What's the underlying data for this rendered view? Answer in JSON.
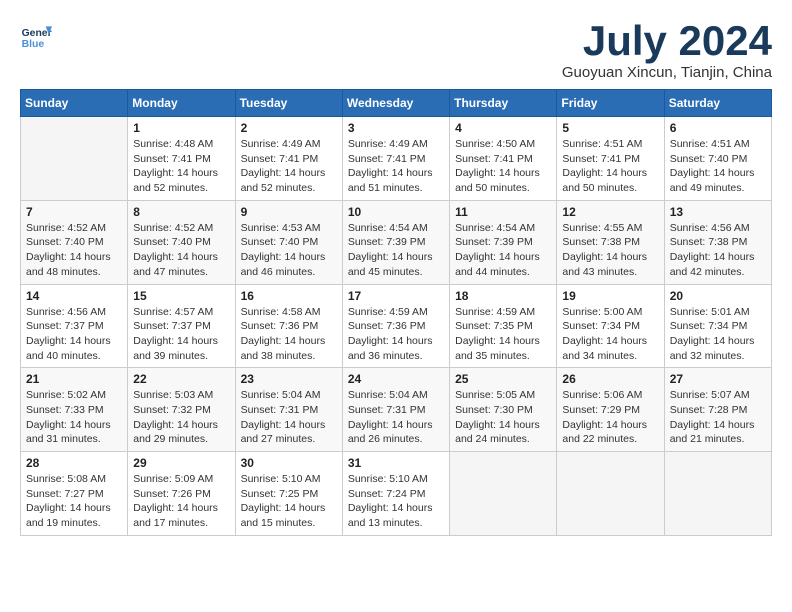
{
  "logo": {
    "line1": "General",
    "line2": "Blue"
  },
  "title": "July 2024",
  "subtitle": "Guoyuan Xincun, Tianjin, China",
  "days_header": [
    "Sunday",
    "Monday",
    "Tuesday",
    "Wednesday",
    "Thursday",
    "Friday",
    "Saturday"
  ],
  "weeks": [
    [
      {
        "day": "",
        "info": ""
      },
      {
        "day": "1",
        "info": "Sunrise: 4:48 AM\nSunset: 7:41 PM\nDaylight: 14 hours\nand 52 minutes."
      },
      {
        "day": "2",
        "info": "Sunrise: 4:49 AM\nSunset: 7:41 PM\nDaylight: 14 hours\nand 52 minutes."
      },
      {
        "day": "3",
        "info": "Sunrise: 4:49 AM\nSunset: 7:41 PM\nDaylight: 14 hours\nand 51 minutes."
      },
      {
        "day": "4",
        "info": "Sunrise: 4:50 AM\nSunset: 7:41 PM\nDaylight: 14 hours\nand 50 minutes."
      },
      {
        "day": "5",
        "info": "Sunrise: 4:51 AM\nSunset: 7:41 PM\nDaylight: 14 hours\nand 50 minutes."
      },
      {
        "day": "6",
        "info": "Sunrise: 4:51 AM\nSunset: 7:40 PM\nDaylight: 14 hours\nand 49 minutes."
      }
    ],
    [
      {
        "day": "7",
        "info": "Sunrise: 4:52 AM\nSunset: 7:40 PM\nDaylight: 14 hours\nand 48 minutes."
      },
      {
        "day": "8",
        "info": "Sunrise: 4:52 AM\nSunset: 7:40 PM\nDaylight: 14 hours\nand 47 minutes."
      },
      {
        "day": "9",
        "info": "Sunrise: 4:53 AM\nSunset: 7:40 PM\nDaylight: 14 hours\nand 46 minutes."
      },
      {
        "day": "10",
        "info": "Sunrise: 4:54 AM\nSunset: 7:39 PM\nDaylight: 14 hours\nand 45 minutes."
      },
      {
        "day": "11",
        "info": "Sunrise: 4:54 AM\nSunset: 7:39 PM\nDaylight: 14 hours\nand 44 minutes."
      },
      {
        "day": "12",
        "info": "Sunrise: 4:55 AM\nSunset: 7:38 PM\nDaylight: 14 hours\nand 43 minutes."
      },
      {
        "day": "13",
        "info": "Sunrise: 4:56 AM\nSunset: 7:38 PM\nDaylight: 14 hours\nand 42 minutes."
      }
    ],
    [
      {
        "day": "14",
        "info": "Sunrise: 4:56 AM\nSunset: 7:37 PM\nDaylight: 14 hours\nand 40 minutes."
      },
      {
        "day": "15",
        "info": "Sunrise: 4:57 AM\nSunset: 7:37 PM\nDaylight: 14 hours\nand 39 minutes."
      },
      {
        "day": "16",
        "info": "Sunrise: 4:58 AM\nSunset: 7:36 PM\nDaylight: 14 hours\nand 38 minutes."
      },
      {
        "day": "17",
        "info": "Sunrise: 4:59 AM\nSunset: 7:36 PM\nDaylight: 14 hours\nand 36 minutes."
      },
      {
        "day": "18",
        "info": "Sunrise: 4:59 AM\nSunset: 7:35 PM\nDaylight: 14 hours\nand 35 minutes."
      },
      {
        "day": "19",
        "info": "Sunrise: 5:00 AM\nSunset: 7:34 PM\nDaylight: 14 hours\nand 34 minutes."
      },
      {
        "day": "20",
        "info": "Sunrise: 5:01 AM\nSunset: 7:34 PM\nDaylight: 14 hours\nand 32 minutes."
      }
    ],
    [
      {
        "day": "21",
        "info": "Sunrise: 5:02 AM\nSunset: 7:33 PM\nDaylight: 14 hours\nand 31 minutes."
      },
      {
        "day": "22",
        "info": "Sunrise: 5:03 AM\nSunset: 7:32 PM\nDaylight: 14 hours\nand 29 minutes."
      },
      {
        "day": "23",
        "info": "Sunrise: 5:04 AM\nSunset: 7:31 PM\nDaylight: 14 hours\nand 27 minutes."
      },
      {
        "day": "24",
        "info": "Sunrise: 5:04 AM\nSunset: 7:31 PM\nDaylight: 14 hours\nand 26 minutes."
      },
      {
        "day": "25",
        "info": "Sunrise: 5:05 AM\nSunset: 7:30 PM\nDaylight: 14 hours\nand 24 minutes."
      },
      {
        "day": "26",
        "info": "Sunrise: 5:06 AM\nSunset: 7:29 PM\nDaylight: 14 hours\nand 22 minutes."
      },
      {
        "day": "27",
        "info": "Sunrise: 5:07 AM\nSunset: 7:28 PM\nDaylight: 14 hours\nand 21 minutes."
      }
    ],
    [
      {
        "day": "28",
        "info": "Sunrise: 5:08 AM\nSunset: 7:27 PM\nDaylight: 14 hours\nand 19 minutes."
      },
      {
        "day": "29",
        "info": "Sunrise: 5:09 AM\nSunset: 7:26 PM\nDaylight: 14 hours\nand 17 minutes."
      },
      {
        "day": "30",
        "info": "Sunrise: 5:10 AM\nSunset: 7:25 PM\nDaylight: 14 hours\nand 15 minutes."
      },
      {
        "day": "31",
        "info": "Sunrise: 5:10 AM\nSunset: 7:24 PM\nDaylight: 14 hours\nand 13 minutes."
      },
      {
        "day": "",
        "info": ""
      },
      {
        "day": "",
        "info": ""
      },
      {
        "day": "",
        "info": ""
      }
    ]
  ]
}
